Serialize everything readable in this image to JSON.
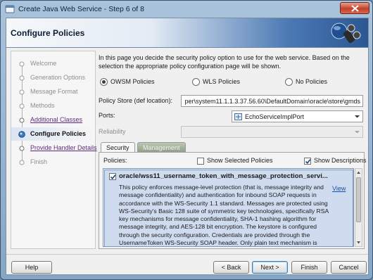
{
  "window": {
    "title": "Create Java Web Service - Step 6 of 8"
  },
  "header": {
    "title": "Configure Policies"
  },
  "steps": [
    {
      "label": "Welcome",
      "state": "done"
    },
    {
      "label": "Generation Options",
      "state": "done"
    },
    {
      "label": "Message Format",
      "state": "done"
    },
    {
      "label": "Methods",
      "state": "done"
    },
    {
      "label": "Additional Classes",
      "state": "link"
    },
    {
      "label": "Configure Policies",
      "state": "current"
    },
    {
      "label": "Provide Handler Details",
      "state": "link"
    },
    {
      "label": "Finish",
      "state": "future"
    }
  ],
  "main": {
    "intro": "In this page you decide the security policy option to use for the web service. Based on the selection the appropriate policy configuration page will be shown.",
    "policy_type": {
      "options": [
        "OWSM Policies",
        "WLS Policies",
        "No Policies"
      ],
      "selected": "OWSM Policies"
    },
    "policy_store": {
      "label": "Policy Store (def location):",
      "value": "per\\system11.1.1.3.37.56.60\\DefaultDomain\\oracle\\store\\gmds"
    },
    "ports": {
      "label": "Ports:",
      "value": "EchoServiceImplPort"
    },
    "reliability": {
      "label": "Reliability",
      "value": ""
    },
    "tabs": [
      {
        "label": "Security",
        "active": true
      },
      {
        "label": "Management",
        "active": false
      }
    ],
    "policies": {
      "label": "Policies:",
      "show_selected_label": "Show Selected Policies",
      "show_selected_checked": false,
      "show_descriptions_label": "Show Descriptions",
      "show_descriptions_checked": true,
      "items": [
        {
          "name": "oracle/wss11_username_token_with_message_protection_servi...",
          "checked": true,
          "view_label": "View",
          "description": "This policy enforces message-level protection (that is, message integrity and message confidentiality) and authentication for inbound SOAP requests in accordance with the WS-Security 1.1 standard. Messages are protected using WS-Security's Basic 128 suite of symmetric key technologies, specifically RSA key mechanisms for message confidentiality, SHA-1 hashing algorithm for message integrity, and AES-128 bit encryption. The keystore is configured through the security configuration. Credentials are provided through the UsernameToken WS-Security SOAP header. Only plain text mechanism is supported. The credentials are authenticated against the configured identity"
        }
      ]
    }
  },
  "buttons": {
    "help": "Help",
    "back": "< Back",
    "next": "Next >",
    "finish": "Finish",
    "cancel": "Cancel"
  },
  "colors": {
    "title_gradient_start": "#a9c3dc",
    "header_accent": "#2b5793",
    "selected_policy_bg": "#cfdcef",
    "link": "#5c2d80",
    "close_button": "#c2402a"
  }
}
